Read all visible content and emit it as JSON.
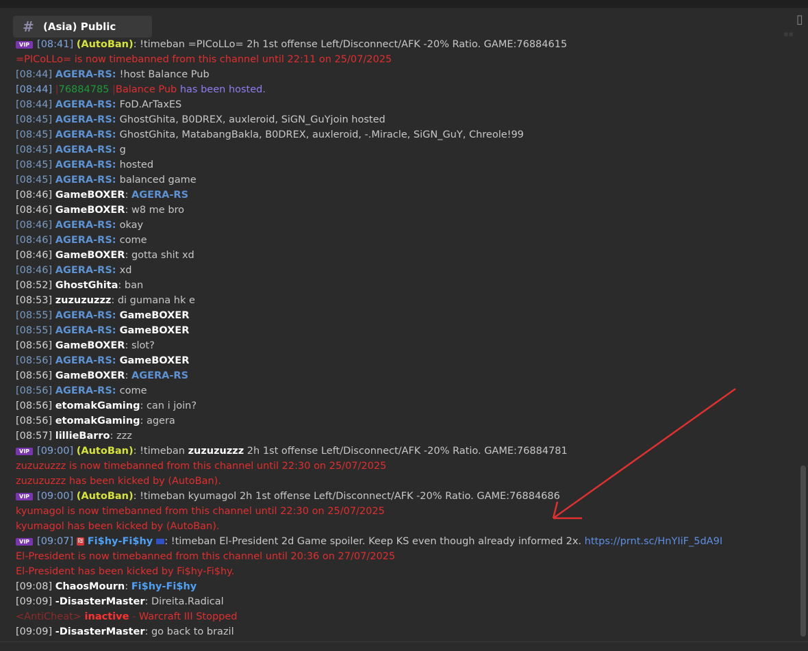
{
  "channel": {
    "name": "(Asia) Public",
    "icon": "hash-icon"
  },
  "vip_label": "VIP",
  "messages": [
    {
      "type": "autoban",
      "ts": "[08:41]",
      "user": "(AutoBan)",
      "text": "!timeban =PICoLLo= 2h 1st offense Left/Disconnect/AFK -20% Ratio. GAME:76884615"
    },
    {
      "type": "red",
      "text": "=PICoLLo= is now timebanned from this channel until 22:11 on 25/07/2025"
    },
    {
      "type": "agera",
      "ts": "[08:44]",
      "user": "AGERA-RS",
      "text": "!host Balance Pub"
    },
    {
      "type": "hosted",
      "ts": "[08:44]",
      "game": "76884785",
      "name": "Balance Pub",
      "text": "has been hosted."
    },
    {
      "type": "agera",
      "ts": "[08:44]",
      "user": "AGERA-RS",
      "text": "FoD.ArTaxES"
    },
    {
      "type": "agera",
      "ts": "[08:45]",
      "user": "AGERA-RS",
      "text": "GhostGhita, B0DREX, auxleroid, SiGN_GuYjoin hosted"
    },
    {
      "type": "agera",
      "ts": "[08:45]",
      "user": "AGERA-RS",
      "text": "GhostGhita, MatabangBakla, B0DREX, auxleroid, -.Miracle, SiGN_GuY, Chreole!99"
    },
    {
      "type": "agera",
      "ts": "[08:45]",
      "user": "AGERA-RS",
      "text": "g"
    },
    {
      "type": "agera",
      "ts": "[08:45]",
      "user": "AGERA-RS",
      "text": "hosted"
    },
    {
      "type": "agera",
      "ts": "[08:45]",
      "user": "AGERA-RS",
      "text": "balanced game"
    },
    {
      "type": "white-agera",
      "ts": "[08:46]",
      "user": "GameBOXER",
      "mention": "AGERA-RS"
    },
    {
      "type": "white",
      "ts": "[08:46]",
      "user": "GameBOXER",
      "text": "w8 me bro"
    },
    {
      "type": "agera",
      "ts": "[08:46]",
      "user": "AGERA-RS",
      "text": "okay"
    },
    {
      "type": "agera",
      "ts": "[08:46]",
      "user": "AGERA-RS",
      "text": "come"
    },
    {
      "type": "white",
      "ts": "[08:46]",
      "user": "GameBOXER",
      "text": "gotta shit xd"
    },
    {
      "type": "agera",
      "ts": "[08:46]",
      "user": "AGERA-RS",
      "text": "xd"
    },
    {
      "type": "white",
      "ts": "[08:52]",
      "user": "GhostGhita",
      "text": "ban"
    },
    {
      "type": "white",
      "ts": "[08:53]",
      "user": "zuzuzuzzz",
      "text": "di gumana hk e"
    },
    {
      "type": "agera-bold",
      "ts": "[08:55]",
      "user": "AGERA-RS",
      "mention": "GameBOXER"
    },
    {
      "type": "agera-bold",
      "ts": "[08:55]",
      "user": "AGERA-RS",
      "mention": "GameBOXER"
    },
    {
      "type": "white",
      "ts": "[08:56]",
      "user": "GameBOXER",
      "text": "slot?"
    },
    {
      "type": "agera-bold",
      "ts": "[08:56]",
      "user": "AGERA-RS",
      "mention": "GameBOXER"
    },
    {
      "type": "white-agera",
      "ts": "[08:56]",
      "user": "GameBOXER",
      "mention": "AGERA-RS"
    },
    {
      "type": "agera",
      "ts": "[08:56]",
      "user": "AGERA-RS",
      "text": "come"
    },
    {
      "type": "white",
      "ts": "[08:56]",
      "user": "etomakGaming",
      "text": "can i join?"
    },
    {
      "type": "white",
      "ts": "[08:56]",
      "user": "etomakGaming",
      "text": "agera"
    },
    {
      "type": "white",
      "ts": "[08:57]",
      "user": "lillieBarro",
      "text": "zzz"
    },
    {
      "type": "autoban-bold",
      "ts": "[09:00]",
      "user": "(AutoBan)",
      "pre": "!timeban",
      "target": "zuzuzuzzz",
      "text": "2h 1st offense Left/Disconnect/AFK -20% Ratio. GAME:76884781"
    },
    {
      "type": "red",
      "text": "zuzuzuzzz is now timebanned from this channel until 22:30 on 25/07/2025"
    },
    {
      "type": "red",
      "text": "zuzuzuzzz has been kicked by (AutoBan)."
    },
    {
      "type": "autoban",
      "ts": "[09:00]",
      "user": "(AutoBan)",
      "text": "!timeban kyumagol 2h 1st offense Left/Disconnect/AFK -20% Ratio. GAME:76884686"
    },
    {
      "type": "red",
      "text": "kyumagol is now timebanned from this channel until 22:30 on 25/07/2025"
    },
    {
      "type": "red",
      "text": "kyumagol has been kicked by (AutoBan)."
    },
    {
      "type": "fishy",
      "ts": "[09:07]",
      "user": "Fi$hy-Fi$hy",
      "text": "!timeban El-President 2d Game spoiler. Keep KS even though already informed 2x.",
      "link": "https://prnt.sc/HnYIiF_5dA9I"
    },
    {
      "type": "red",
      "text": "El-President is now timebanned from this channel until 20:36 on 27/07/2025"
    },
    {
      "type": "red",
      "text": "El-President has been kicked by Fi$hy-Fi$hy."
    },
    {
      "type": "white-fishy",
      "ts": "[09:08]",
      "user": "ChaosMourn",
      "mention": "Fi$hy-Fi$hy"
    },
    {
      "type": "white",
      "ts": "[09:09]",
      "user": "-DisasterMaster",
      "text": "Direita.Radical"
    },
    {
      "type": "anticheat",
      "tag": "<AntiCheat>",
      "status": "inactive",
      "sep": "-",
      "text": "Warcraft III Stopped"
    },
    {
      "type": "white",
      "ts": "[09:09]",
      "user": "-DisasterMaster",
      "text": "go back to brazil"
    }
  ],
  "colors": {
    "background": "#2b2b2b",
    "agera": "#5d93d3",
    "red": "#e22e2e",
    "autoban": "#d6e33a",
    "vip": "#7a36b0",
    "arrow": "#e03030"
  }
}
